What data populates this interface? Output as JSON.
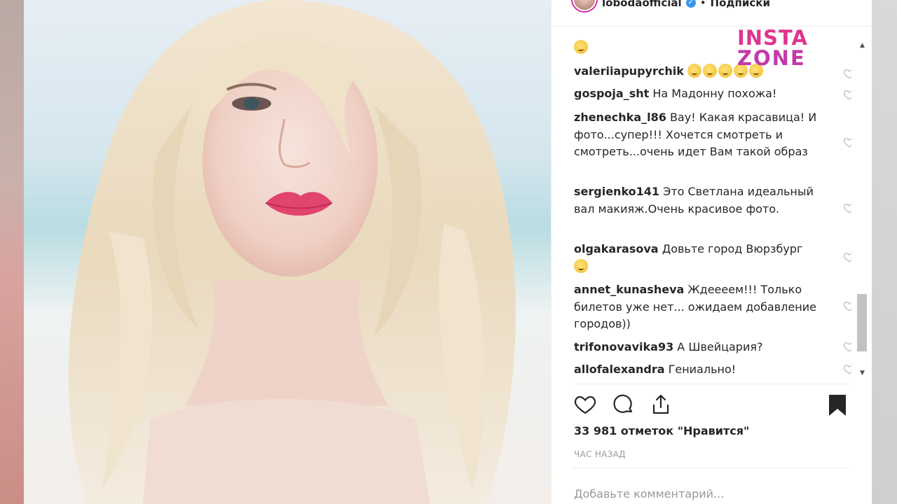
{
  "post": {
    "username": "lobodaofficial",
    "verified_mark": "✓",
    "separator": "•",
    "follow_label": "Подписки"
  },
  "watermark": {
    "line1": "INSTA",
    "line2": "ZONE"
  },
  "comments": [
    {
      "user": "",
      "text": "",
      "emoji_only": true
    },
    {
      "user": "valeriiapupyrchik",
      "text": "",
      "emoji_count": 5
    },
    {
      "user": "gospoja_sht",
      "text": "На Мадонну похожа!"
    },
    {
      "user": "zhenechka_l86",
      "text": "Вау! Какая красавица! И фото...супер!!! Хочется смотреть и смотреть...очень идет Вам такой образ"
    },
    {
      "user": "sergienko141",
      "text": "Это Светлана идеальный вал макияж.Очень красивое фото."
    },
    {
      "user": "olgakarasova",
      "text": "Довьте город Вюрзбург"
    },
    {
      "user": "annet_kunasheva",
      "text": "Ждеееем!!! Только билетов уже нет... ожидаем добавление городов))"
    },
    {
      "user": "trifonovavika93",
      "text": "А Швейцария?"
    },
    {
      "user": "allofalexandra",
      "text": "Гениально!"
    }
  ],
  "actions": {
    "like_icon": "heart-icon",
    "comment_icon": "comment-icon",
    "share_icon": "share-icon",
    "save_icon": "bookmark-icon"
  },
  "likes_text": "33 981 отметок \"Нравится\"",
  "time_text": "ЧАС НАЗАД",
  "add_comment_placeholder": "Добавьте комментарий...",
  "colors": {
    "text": "#262626",
    "muted": "#999999",
    "verified": "#3897f0",
    "watermark_pink": "#e0348f",
    "watermark_purple": "#c23aa8"
  }
}
